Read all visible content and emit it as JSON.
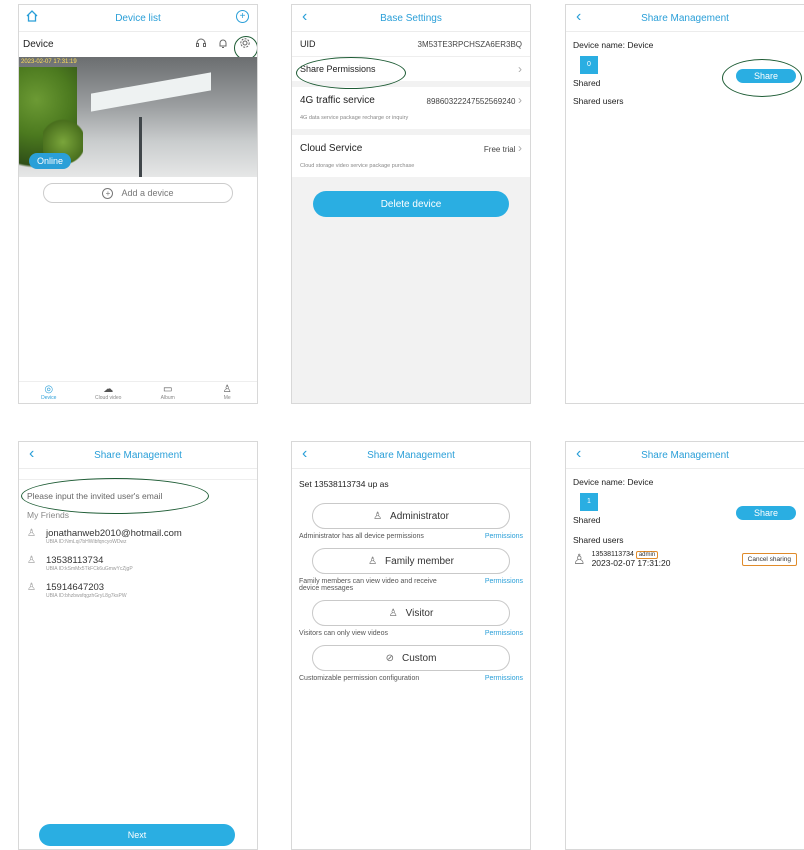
{
  "screen1": {
    "title": "Device list",
    "plus_glyph": "+",
    "device_name": "Device",
    "video_timestamp": "2023-02-07 17:31:19",
    "online_label": "Online",
    "add_device_label": "Add a device",
    "tabs": [
      {
        "label": "Device",
        "icon": "camera-icon",
        "active": true
      },
      {
        "label": "Cloud video",
        "icon": "cloud-icon",
        "active": false
      },
      {
        "label": "Album",
        "icon": "album-icon",
        "active": false
      },
      {
        "label": "Me",
        "icon": "person-icon",
        "active": false
      }
    ]
  },
  "screen2": {
    "title": "Base Settings",
    "uid_label": "UID",
    "uid_value": "3M53TE3RPCHSZA6ER3BQ",
    "share_permissions_label": "Share Permissions",
    "traffic_label": "4G traffic service",
    "traffic_value": "89860322247552569240",
    "traffic_sub": "4G data service package recharge or inquiry",
    "cloud_label": "Cloud Service",
    "cloud_value": "Free trial",
    "cloud_sub": "Cloud storage video service package purchase",
    "delete_label": "Delete device"
  },
  "screen3": {
    "title": "Share Management",
    "device_name_label": "Device name:  Device",
    "shared_count": "0",
    "shared_label": "Shared",
    "share_button": "Share",
    "shared_users_label": "Shared users"
  },
  "screen4": {
    "title": "Share Management",
    "email_placeholder": "Please input the invited user's email",
    "friends_label": "My Friends",
    "friends": [
      {
        "name": "jonathanweb2010@hotmail.com",
        "uid": "UBIA ID:NmLqi7bHWibfqncyoWDwz"
      },
      {
        "name": "13538113734",
        "uid": "UBIA ID:kSmMx5TkFCk6uGmwYcZjgP"
      },
      {
        "name": "15914647203",
        "uid": "UBIA ID:bhzbwsfqgzhGryL8g7ksPW"
      }
    ],
    "next_button": "Next"
  },
  "screen5": {
    "title": "Share Management",
    "set_label": "Set 13538113734 up as",
    "roles": [
      {
        "name": "Administrator",
        "icon": "admin-user-icon",
        "desc": "Administrator has all device permissions",
        "link": "Permissions"
      },
      {
        "name": "Family member",
        "icon": "family-icon",
        "desc": "Family members can view video and receive device messages",
        "link": "Permissions"
      },
      {
        "name": "Visitor",
        "icon": "visitor-icon",
        "desc": "Visitors can only view videos",
        "link": "Permissions"
      },
      {
        "name": "Custom",
        "icon": "custom-icon",
        "desc": "Customizable permission configuration",
        "link": "Permissions"
      }
    ]
  },
  "screen6": {
    "title": "Share Management",
    "device_name_label": "Device name:  Device",
    "shared_count": "1",
    "shared_label": "Shared",
    "share_button": "Share",
    "shared_users_label": "Shared users",
    "user_phone": "13538113734",
    "user_role": "admin",
    "user_date": "2023-02-07 17:31:20",
    "cancel_button": "Cancel sharing"
  },
  "colors": {
    "accent": "#2a9fd8",
    "button": "#2aaee2",
    "highlight_ring": "#1e5c35",
    "warning_border": "#e08b2a"
  }
}
